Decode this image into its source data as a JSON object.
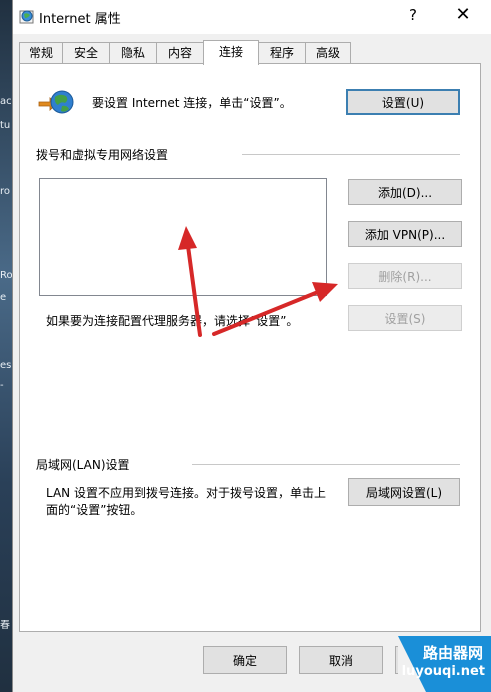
{
  "window": {
    "title": "Internet 属性",
    "help_glyph": "?",
    "close_glyph": "✕"
  },
  "tabs": [
    {
      "label": "常规"
    },
    {
      "label": "安全"
    },
    {
      "label": "隐私"
    },
    {
      "label": "内容"
    },
    {
      "label": "连接",
      "active": true
    },
    {
      "label": "程序"
    },
    {
      "label": "高级"
    }
  ],
  "connection": {
    "intro_text": "要设置 Internet 连接，单击“设置”。",
    "setup_button": "设置(U)"
  },
  "vpn_section": {
    "label": "拨号和虚拟专用网络设置",
    "add_button": "添加(D)...",
    "add_vpn_button": "添加 VPN(P)...",
    "remove_button": "删除(R)...",
    "settings_button": "设置(S)",
    "proxy_hint": "如果要为连接配置代理服务器，请选择“设置”。"
  },
  "lan_section": {
    "label": "局域网(LAN)设置",
    "description": "LAN 设置不应用到拨号连接。对于拨号设置，单击上面的“设置”按钮。",
    "lan_button": "局域网设置(L)"
  },
  "footer": {
    "ok_button": "确定",
    "cancel_button": "取消"
  },
  "watermark": {
    "site_cn": "路由器网",
    "site_en": "luyouqi.net"
  },
  "colors": {
    "arrow": "#d62828",
    "dialog_bg": "#f0f0f0",
    "primary_border": "#3c7fb1",
    "watermark_bg": "#1a8fd8"
  }
}
